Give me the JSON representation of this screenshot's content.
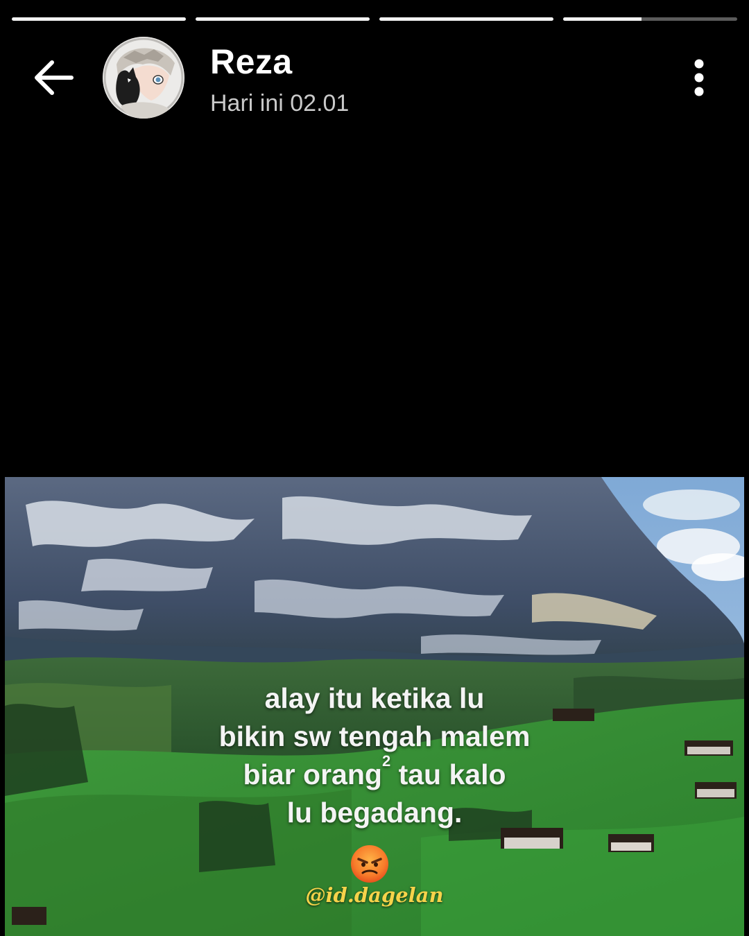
{
  "progress": {
    "segments": [
      1,
      1,
      1,
      0.45
    ],
    "fill_color": "#f2f2f2",
    "track_color": "#5b5b5b"
  },
  "header": {
    "back_icon": "arrow-left-icon",
    "avatar_icon": "profile-avatar",
    "name": "Reza",
    "time": "Hari ini 02.01",
    "menu_icon": "more-vertical-icon"
  },
  "media": {
    "caption": {
      "line1": "alay itu ketika lu",
      "line2": "bikin sw tengah malem",
      "line3a": "biar orang",
      "line3_sup": "2",
      "line3b": " tau kalo",
      "line4": "lu begadang."
    },
    "emoji": "angry-face-icon",
    "watermark": "@id.dagelan",
    "watermark_color": "#f6d34a"
  }
}
